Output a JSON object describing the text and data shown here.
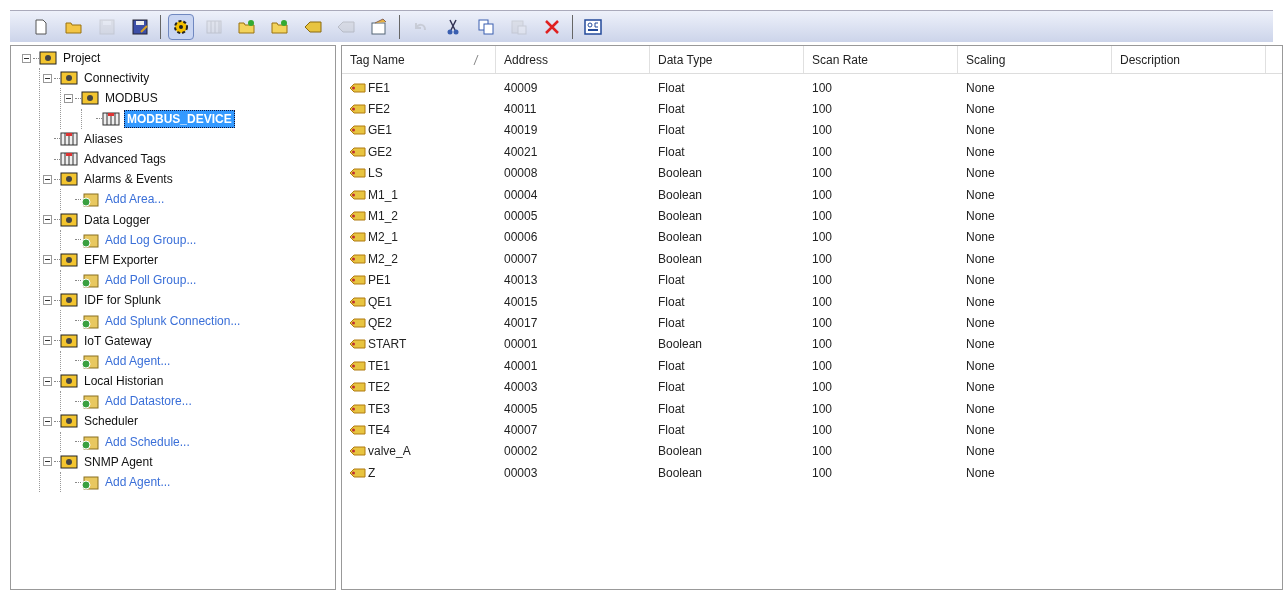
{
  "toolbar": [
    {
      "kind": "new",
      "disabled": false,
      "selected": false
    },
    {
      "kind": "open",
      "disabled": false,
      "selected": false
    },
    {
      "kind": "save",
      "disabled": true,
      "selected": false
    },
    {
      "kind": "saveas",
      "disabled": false,
      "selected": false
    },
    {
      "kind": "sep"
    },
    {
      "kind": "gear",
      "disabled": false,
      "selected": true
    },
    {
      "kind": "grid",
      "disabled": true,
      "selected": false
    },
    {
      "kind": "folder",
      "disabled": false,
      "selected": false
    },
    {
      "kind": "folder",
      "disabled": false,
      "selected": false
    },
    {
      "kind": "tag",
      "disabled": false,
      "selected": false
    },
    {
      "kind": "tag",
      "disabled": true,
      "selected": false
    },
    {
      "kind": "props",
      "disabled": false,
      "selected": false
    },
    {
      "kind": "sep"
    },
    {
      "kind": "undo",
      "disabled": true,
      "selected": false
    },
    {
      "kind": "cut",
      "disabled": false,
      "selected": false
    },
    {
      "kind": "copy",
      "disabled": false,
      "selected": false
    },
    {
      "kind": "paste",
      "disabled": true,
      "selected": false
    },
    {
      "kind": "delete",
      "disabled": false,
      "selected": false
    },
    {
      "kind": "sep"
    },
    {
      "kind": "qc",
      "disabled": false,
      "selected": false
    }
  ],
  "tree": [
    {
      "label": "Project",
      "kind": "node",
      "expanded": true,
      "selected": false,
      "children": [
        {
          "label": "Connectivity",
          "kind": "node",
          "expanded": true,
          "selected": false,
          "children": [
            {
              "label": "MODBUS",
              "kind": "node",
              "expanded": true,
              "selected": false,
              "children": [
                {
                  "label": "MODBUS_DEVICE",
                  "kind": "leaf",
                  "selected": true
                }
              ]
            }
          ]
        },
        {
          "label": "Aliases",
          "kind": "leaf",
          "selected": false
        },
        {
          "label": "Advanced Tags",
          "kind": "leaf",
          "selected": false
        },
        {
          "label": "Alarms & Events",
          "kind": "node",
          "expanded": true,
          "selected": false,
          "children": [
            {
              "label": "Add Area...",
              "kind": "action",
              "selected": false
            }
          ]
        },
        {
          "label": "Data Logger",
          "kind": "node",
          "expanded": true,
          "selected": false,
          "children": [
            {
              "label": "Add Log Group...",
              "kind": "action",
              "selected": false
            }
          ]
        },
        {
          "label": "EFM Exporter",
          "kind": "node",
          "expanded": true,
          "selected": false,
          "children": [
            {
              "label": "Add Poll Group...",
              "kind": "action",
              "selected": false
            }
          ]
        },
        {
          "label": "IDF for Splunk",
          "kind": "node",
          "expanded": true,
          "selected": false,
          "children": [
            {
              "label": "Add Splunk Connection...",
              "kind": "action",
              "selected": false
            }
          ]
        },
        {
          "label": "IoT Gateway",
          "kind": "node",
          "expanded": true,
          "selected": false,
          "children": [
            {
              "label": "Add Agent...",
              "kind": "action",
              "selected": false
            }
          ]
        },
        {
          "label": "Local Historian",
          "kind": "node",
          "expanded": true,
          "selected": false,
          "children": [
            {
              "label": "Add Datastore...",
              "kind": "action",
              "selected": false
            }
          ]
        },
        {
          "label": "Scheduler",
          "kind": "node",
          "expanded": true,
          "selected": false,
          "children": [
            {
              "label": "Add Schedule...",
              "kind": "action",
              "selected": false
            }
          ]
        },
        {
          "label": "SNMP Agent",
          "kind": "node",
          "expanded": true,
          "selected": false,
          "children": [
            {
              "label": "Add Agent...",
              "kind": "action",
              "selected": false
            }
          ]
        }
      ]
    }
  ],
  "table": {
    "columns": [
      {
        "label": "Tag Name",
        "sorted": true
      },
      {
        "label": "Address",
        "sorted": false
      },
      {
        "label": "Data Type",
        "sorted": false
      },
      {
        "label": "Scan Rate",
        "sorted": false
      },
      {
        "label": "Scaling",
        "sorted": false
      },
      {
        "label": "Description",
        "sorted": false
      }
    ],
    "rows": [
      [
        "FE1",
        "40009",
        "Float",
        "100",
        "None"
      ],
      [
        "FE2",
        "40011",
        "Float",
        "100",
        "None"
      ],
      [
        "GE1",
        "40019",
        "Float",
        "100",
        "None"
      ],
      [
        "GE2",
        "40021",
        "Float",
        "100",
        "None"
      ],
      [
        "LS",
        "00008",
        "Boolean",
        "100",
        "None"
      ],
      [
        "M1_1",
        "00004",
        "Boolean",
        "100",
        "None"
      ],
      [
        "M1_2",
        "00005",
        "Boolean",
        "100",
        "None"
      ],
      [
        "M2_1",
        "00006",
        "Boolean",
        "100",
        "None"
      ],
      [
        "M2_2",
        "00007",
        "Boolean",
        "100",
        "None"
      ],
      [
        "PE1",
        "40013",
        "Float",
        "100",
        "None"
      ],
      [
        "QE1",
        "40015",
        "Float",
        "100",
        "None"
      ],
      [
        "QE2",
        "40017",
        "Float",
        "100",
        "None"
      ],
      [
        "START",
        "00001",
        "Boolean",
        "100",
        "None"
      ],
      [
        "TE1",
        "40001",
        "Float",
        "100",
        "None"
      ],
      [
        "TE2",
        "40003",
        "Float",
        "100",
        "None"
      ],
      [
        "TE3",
        "40005",
        "Float",
        "100",
        "None"
      ],
      [
        "TE4",
        "40007",
        "Float",
        "100",
        "None"
      ],
      [
        "valve_A",
        "00002",
        "Boolean",
        "100",
        "None"
      ],
      [
        "Z",
        "00003",
        "Boolean",
        "100",
        "None"
      ]
    ]
  }
}
